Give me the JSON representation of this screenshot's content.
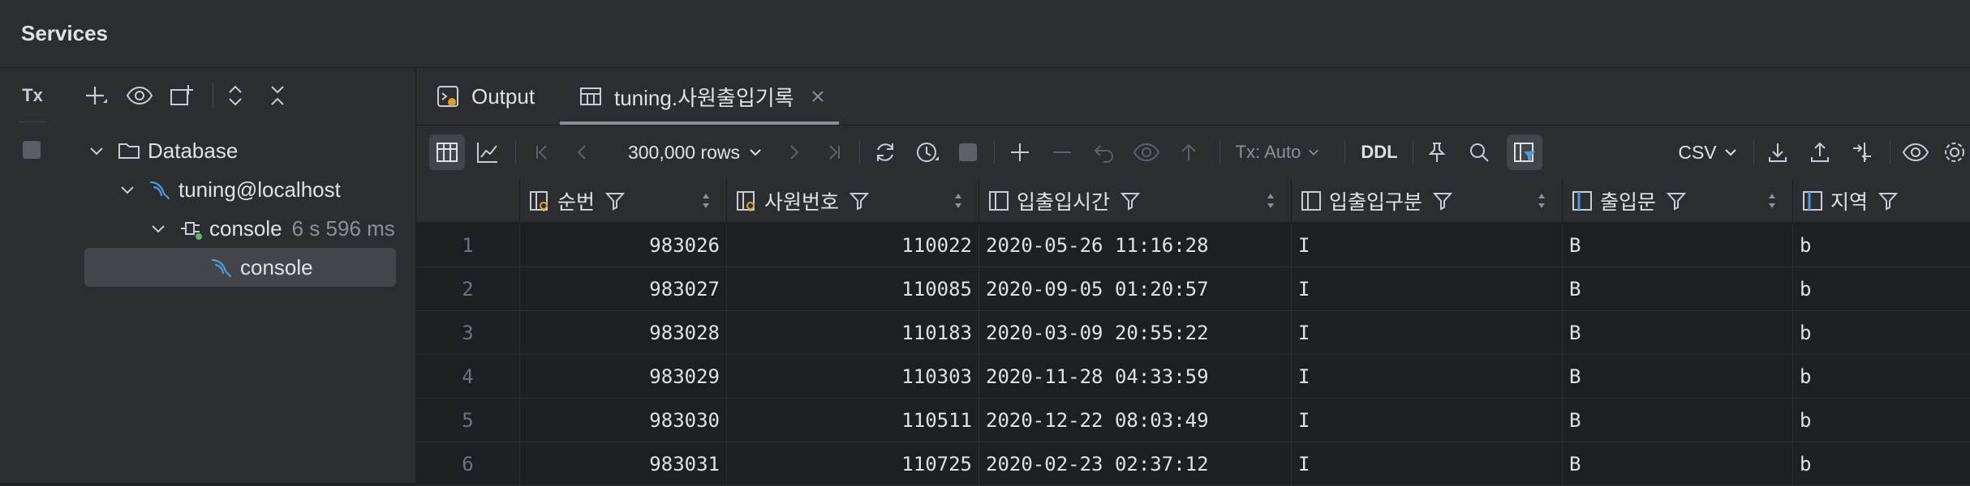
{
  "header": {
    "title": "Services"
  },
  "left_panel": {
    "toolbar": [
      {
        "name": "tx-icon",
        "label": "Tx"
      },
      {
        "name": "add-icon"
      },
      {
        "name": "eye-icon"
      },
      {
        "name": "new-window-icon"
      },
      {
        "name": "expand-all-icon"
      },
      {
        "name": "collapse-all-icon"
      }
    ],
    "tree": [
      {
        "label": "Database",
        "icon": "folder-icon",
        "expanded": true
      },
      {
        "label": "tuning@localhost",
        "icon": "mysql-icon",
        "expanded": true
      },
      {
        "label": "console",
        "icon": "console-icon",
        "expanded": true,
        "meta": "6 s 596 ms"
      },
      {
        "label": "console",
        "icon": "mysql-icon",
        "selected": true
      }
    ]
  },
  "tabs": [
    {
      "label": "Output",
      "icon": "output-icon",
      "active": false
    },
    {
      "label": "tuning.사원출입기록",
      "icon": "table-icon",
      "active": true,
      "closable": true
    }
  ],
  "toolbar": {
    "rows_label": "300,000 rows",
    "tx_label": "Tx: Auto",
    "ddl_label": "DDL",
    "format_label": "CSV"
  },
  "grid": {
    "columns": [
      {
        "name": "순번",
        "icon": "key-column-icon"
      },
      {
        "name": "사원번호",
        "icon": "key-column-icon"
      },
      {
        "name": "입출입시간",
        "icon": "column-icon"
      },
      {
        "name": "입출입구분",
        "icon": "column-icon"
      },
      {
        "name": "출입문",
        "icon": "index-column-icon"
      },
      {
        "name": "지역",
        "icon": "index-column-icon"
      }
    ],
    "rows": [
      {
        "n": "1",
        "c": [
          "983026",
          "110022",
          "2020-05-26 11:16:28",
          "I",
          "B",
          "b"
        ]
      },
      {
        "n": "2",
        "c": [
          "983027",
          "110085",
          "2020-09-05 01:20:57",
          "I",
          "B",
          "b"
        ]
      },
      {
        "n": "3",
        "c": [
          "983028",
          "110183",
          "2020-03-09 20:55:22",
          "I",
          "B",
          "b"
        ]
      },
      {
        "n": "4",
        "c": [
          "983029",
          "110303",
          "2020-11-28 04:33:59",
          "I",
          "B",
          "b"
        ]
      },
      {
        "n": "5",
        "c": [
          "983030",
          "110511",
          "2020-12-22 08:03:49",
          "I",
          "B",
          "b"
        ]
      },
      {
        "n": "6",
        "c": [
          "983031",
          "110725",
          "2020-02-23 02:37:12",
          "I",
          "B",
          "b"
        ]
      }
    ]
  },
  "colors": {
    "accent": "#3574f0",
    "mysql": "#4a9cdb",
    "bg": "#1e1f22",
    "panel": "#2b2d30"
  }
}
